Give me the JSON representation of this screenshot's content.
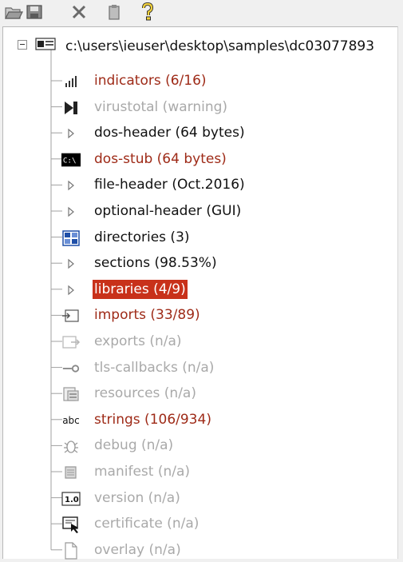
{
  "toolbar": {
    "buttons": [
      {
        "name": "open-icon"
      },
      {
        "name": "save-icon"
      },
      {
        "name": "close-file-icon"
      },
      {
        "name": "clipboard-icon"
      },
      {
        "name": "help-icon"
      }
    ]
  },
  "tree": {
    "root": {
      "label": "c:\\users\\ieuser\\desktop\\samples\\dc03077893",
      "expander": "−"
    },
    "items": [
      {
        "label": "indicators (6/16)",
        "icon": "bar-chart-icon",
        "style": "red"
      },
      {
        "label": "virustotal (warning)",
        "icon": "virustotal-icon",
        "style": "gray"
      },
      {
        "label": "dos-header (64 bytes)",
        "icon": "expand-arrow-icon",
        "style": "black"
      },
      {
        "label": "dos-stub (64 bytes)",
        "icon": "console-icon",
        "style": "red"
      },
      {
        "label": "file-header (Oct.2016)",
        "icon": "expand-arrow-icon",
        "style": "black"
      },
      {
        "label": "optional-header (GUI)",
        "icon": "expand-arrow-icon",
        "style": "black"
      },
      {
        "label": "directories (3)",
        "icon": "directories-icon",
        "style": "black"
      },
      {
        "label": "sections (98.53%)",
        "icon": "expand-arrow-icon",
        "style": "black"
      },
      {
        "label": "libraries (4/9)",
        "icon": "expand-arrow-icon",
        "style": "selected"
      },
      {
        "label": "imports (33/89)",
        "icon": "imports-icon",
        "style": "red"
      },
      {
        "label": "exports (n/a)",
        "icon": "exports-icon",
        "style": "gray"
      },
      {
        "label": "tls-callbacks (n/a)",
        "icon": "key-icon",
        "style": "gray"
      },
      {
        "label": "resources (n/a)",
        "icon": "resources-icon",
        "style": "gray"
      },
      {
        "label": "strings (106/934)",
        "icon": "abc-icon",
        "style": "red"
      },
      {
        "label": "debug (n/a)",
        "icon": "bug-icon",
        "style": "gray"
      },
      {
        "label": "manifest (n/a)",
        "icon": "scroll-icon",
        "style": "gray"
      },
      {
        "label": "version (n/a)",
        "icon": "version-icon",
        "style": "gray"
      },
      {
        "label": "certificate (n/a)",
        "icon": "certificate-icon",
        "style": "gray"
      },
      {
        "label": "overlay (n/a)",
        "icon": "page-icon",
        "style": "gray"
      }
    ],
    "icon_text": {
      "abc": "abc",
      "version": "1.0",
      "console": "C:\\"
    }
  },
  "colors": {
    "red_text": "#9e2a17",
    "gray_text": "#a9a9a9",
    "selection": "#c8311a"
  }
}
